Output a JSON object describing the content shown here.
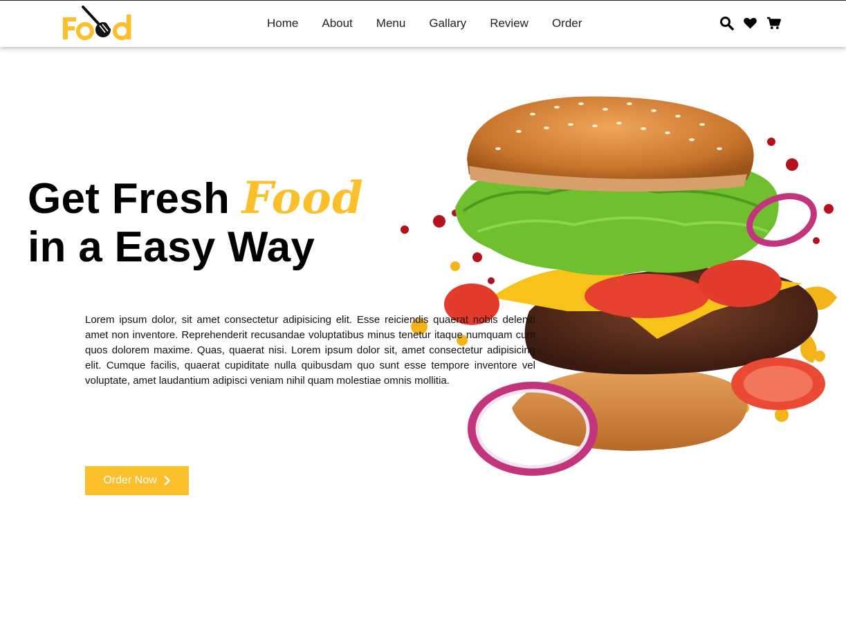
{
  "brand": {
    "logo_text": "Food",
    "accent_color": "#fbbf2c"
  },
  "nav": {
    "links": [
      "Home",
      "About",
      "Menu",
      "Gallary",
      "Review",
      "Order"
    ]
  },
  "nav_icons": [
    "search-icon",
    "heart-icon",
    "cart-icon"
  ],
  "hero": {
    "title_part1": "Get Fresh ",
    "title_accent": "Food",
    "title_line2": "in a Easy Way",
    "description": "Lorem ipsum dolor, sit amet consectetur adipisicing elit. Esse reiciendis quaerat nobis deleniti amet non inventore. Reprehenderit recusandae voluptatibus minus tenetur itaque numquam cum quos dolorem maxime. Quas, quaerat nisi. Lorem ipsum dolor sit, amet consectetur adipisicing elit. Cumque facilis, quaerat cupiditate nulla quibusdam quo sunt esse tempore inventore vel voluptate, amet laudantium adipisci veniam nihil quam molestiae omnis mollitia.",
    "button_label": "Order Now"
  },
  "colors": {
    "accent": "#fbbf2c",
    "text": "#000000",
    "background": "#ffffff"
  }
}
